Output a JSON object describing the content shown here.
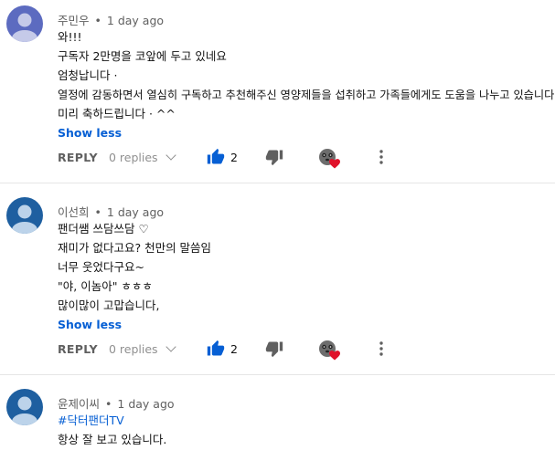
{
  "comments": [
    {
      "author": "주민우",
      "time": "1 day ago",
      "avatar_color": "#5c6bc0",
      "lines": [
        "와!!!",
        "구독자 2만명을 코앞에 두고 있네요",
        "엄청납니다 ·",
        "열정에  감동하면서 열심히 구독하고 추천해주신 영양제들을 섭취하고 가족들에게도 도움을 나누고 있습니다",
        "미리 축하드립니다 · ^^"
      ],
      "show_less": "Show less",
      "reply": "REPLY",
      "replies": "0 replies",
      "likes": "2"
    },
    {
      "author": "이선희",
      "time": "1 day ago",
      "avatar_color": "#1e5fa0",
      "lines": [
        "팬더쌤 쓰담쓰담 ♡",
        "재미가 없다고요? 천만의 말씀임",
        "너무 웃었다구요~",
        "\"야, 이놈아\" ㅎㅎㅎ",
        "많이많이 고맙습니다,"
      ],
      "show_less": "Show less",
      "reply": "REPLY",
      "replies": "0 replies",
      "likes": "2"
    },
    {
      "author": "윤제이씨",
      "time": "1 day ago",
      "avatar_color": "#1e5fa0",
      "hashtag": "#닥터팬더TV",
      "lines": [
        "항상 잘 보고 있습니다."
      ]
    }
  ],
  "meta_separator": "•",
  "icons": {
    "like": "thumbs-up-icon",
    "dislike": "thumbs-down-icon",
    "creator_heart": "creator-heart-icon",
    "more": "more-vertical-icon",
    "replies_toggle": "chevron-down-icon"
  },
  "colors": {
    "link": "#065fd4",
    "meta": "#606060",
    "heart": "#e0122a"
  }
}
